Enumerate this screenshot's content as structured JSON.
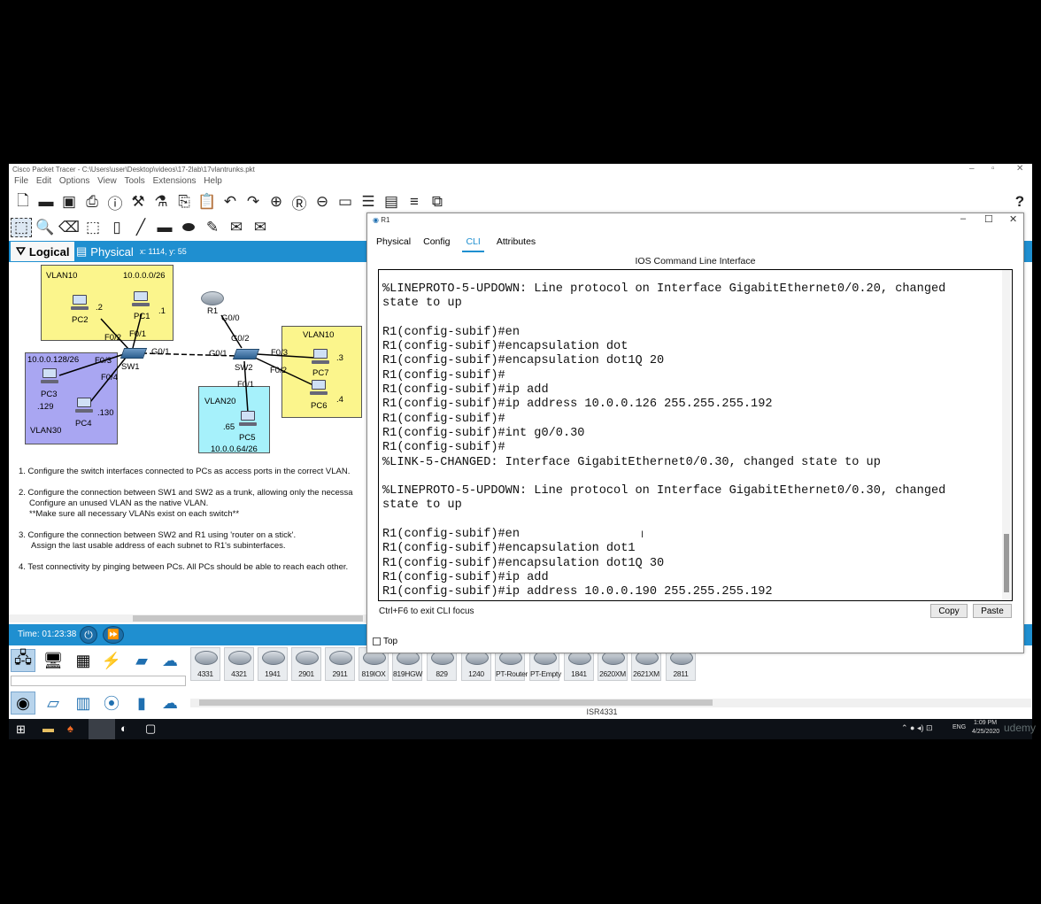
{
  "app": {
    "title": "Cisco Packet Tracer - C:\\Users\\user\\Desktop\\videos\\17-2lab\\17vlantrunks.pkt",
    "menus": [
      "File",
      "Edit",
      "Options",
      "View",
      "Tools",
      "Extensions",
      "Help"
    ],
    "help_glyph": "?"
  },
  "workspace": {
    "logical_tab": "Logical",
    "physical_tab": "Physical",
    "coords": "x: 1114, y: 55"
  },
  "topology": {
    "vlan10_left_label": "VLAN10",
    "vlan10_left_subnet": "10.0.0.0/26",
    "pc2": "PC2",
    "pc2_ip": ".2",
    "pc1": "PC1",
    "pc1_ip": ".1",
    "f02": "F0/2",
    "f01": "F0/1",
    "vlan30_subnet": "10.0.0.128/26",
    "f03_sw1": "F0/3",
    "f04_sw1": "F0/4",
    "sw1": "SW1",
    "pc3": "PC3",
    "pc3_ip": ".129",
    "pc4": "PC4",
    "pc4_ip": ".130",
    "vlan30_label": "VLAN30",
    "g01_sw1": "G0/1",
    "g01_sw2": "G0/1",
    "r1": "R1",
    "g00": "G0/0",
    "g02": "G0/2",
    "sw2": "SW2",
    "f03_sw2": "F0/3",
    "f02_sw2": "F0/2",
    "f01_sw2": "F0/1",
    "vlan10_right_label": "VLAN10",
    "pc7": "PC7",
    "pc7_ip": ".3",
    "pc6": "PC6",
    "pc6_ip": ".4",
    "vlan20_label": "VLAN20",
    "pc5": "PC5",
    "pc5_ip": ".65",
    "vlan20_subnet": "10.0.0.64/26"
  },
  "tasks": [
    "1. Configure the switch interfaces connected to PCs as access ports in the correct VLAN.",
    "2. Configure the connection between SW1 and SW2 as a trunk, allowing only the necessa",
    "Configure an unused VLAN as the native VLAN.",
    "**Make sure all necessary VLANs exist on each switch**",
    "3. Configure the connection between SW2 and R1 using 'router on a stick'.",
    "Assign the last usable address of each subnet to R1's subinterfaces.",
    "4. Test connectivity by pinging between PCs.  All PCs should be able to reach each other."
  ],
  "status": {
    "time": "Time: 01:23:38"
  },
  "device_models": [
    "4331",
    "4321",
    "1941",
    "2901",
    "2911",
    "819IOX",
    "819HGW",
    "829",
    "1240",
    "PT-Router",
    "PT-Empty",
    "1841",
    "2620XM",
    "2621XM",
    "2811"
  ],
  "selected_device": "ISR4331",
  "tray": {
    "lang": "ENG",
    "time": "1:09 PM",
    "date": "4/25/2020",
    "watermark": "udemy"
  },
  "r1_window": {
    "title": "R1",
    "tabs": [
      "Physical",
      "Config",
      "CLI",
      "Attributes"
    ],
    "active_tab": "CLI",
    "heading": "IOS Command Line Interface",
    "cli_text": "%LINEPROTO-5-UPDOWN: Line protocol on Interface GigabitEthernet0/0.20, changed\nstate to up\n\nR1(config-subif)#en\nR1(config-subif)#encapsulation dot\nR1(config-subif)#encapsulation dot1Q 20\nR1(config-subif)#\nR1(config-subif)#ip add\nR1(config-subif)#ip address 10.0.0.126 255.255.255.192\nR1(config-subif)#\nR1(config-subif)#int g0/0.30\nR1(config-subif)#\n%LINK-5-CHANGED: Interface GigabitEthernet0/0.30, changed state to up\n\n%LINEPROTO-5-UPDOWN: Line protocol on Interface GigabitEthernet0/0.30, changed\nstate to up\n\nR1(config-subif)#en\nR1(config-subif)#encapsulation dot1\nR1(config-subif)#encapsulation dot1Q 30\nR1(config-subif)#ip add\nR1(config-subif)#ip address 10.0.0.190 255.255.255.192",
    "hint": "Ctrl+F6 to exit CLI focus",
    "copy_label": "Copy",
    "paste_label": "Paste",
    "top_label": "Top"
  }
}
